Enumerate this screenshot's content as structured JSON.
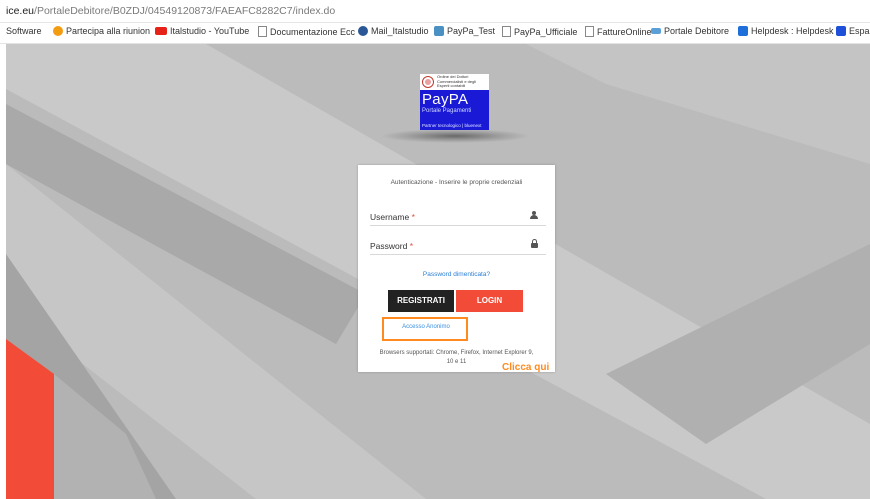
{
  "browser": {
    "url_host": "ice.eu",
    "url_path": "/PortaleDebitore/B0ZDJ/04549120873/FAEAFC8282C7/index.do"
  },
  "bookmarks": [
    {
      "label": "Software",
      "icon": "none",
      "color": ""
    },
    {
      "label": "Partecipa alla riunion",
      "icon": "meeting-icon",
      "color": "#f39c12"
    },
    {
      "label": "Italstudio - YouTube",
      "icon": "youtube-icon",
      "color": "#e62117"
    },
    {
      "label": "Documentazione Ecc",
      "icon": "page-icon",
      "color": "#888888"
    },
    {
      "label": "Mail_Italstudio",
      "icon": "mail-icon",
      "color": "#2b5797"
    },
    {
      "label": "PayPa_Test",
      "icon": "paypa-icon",
      "color": "#4a90c2"
    },
    {
      "label": "PayPa_Ufficiale",
      "icon": "page-icon",
      "color": "#888888"
    },
    {
      "label": "FattureOnline",
      "icon": "page-icon",
      "color": "#888888"
    },
    {
      "label": "Portale Debitore",
      "icon": "portal-icon",
      "color": "#5aa0d8"
    },
    {
      "label": "Helpdesk : Helpdesk",
      "icon": "helpdesk-icon",
      "color": "#1e6fd9"
    },
    {
      "label": "Espar",
      "icon": "espar-icon",
      "color": "#1e4fd9"
    }
  ],
  "logo": {
    "org_text": "Ordine dei Dottori Commercialisti e degli Esperti contabili",
    "brand": "PayPA",
    "subtitle": "Portale Pagamenti",
    "footer": "Partner tecnologico | bluenext"
  },
  "login": {
    "title": "Autenticazione - Inserire le proprie credenziali",
    "username_label": "Username",
    "password_label": "Password",
    "required_mark": "*",
    "forgot_password": "Password dimenticata?",
    "register_button": "REGISTRATI",
    "login_button": "LOGIN",
    "anonymous_link": "Accesso Anonimo",
    "browsers_note": "Browsers supportati: Chrome, Firefox, Internet Explorer 9, 10 e 11"
  },
  "annotation": {
    "text": "Clicca qui",
    "color": "#ff8a1f"
  },
  "colors": {
    "login_red": "#f24c39",
    "register_dark": "#222222",
    "link_blue": "#2a7fd4"
  }
}
